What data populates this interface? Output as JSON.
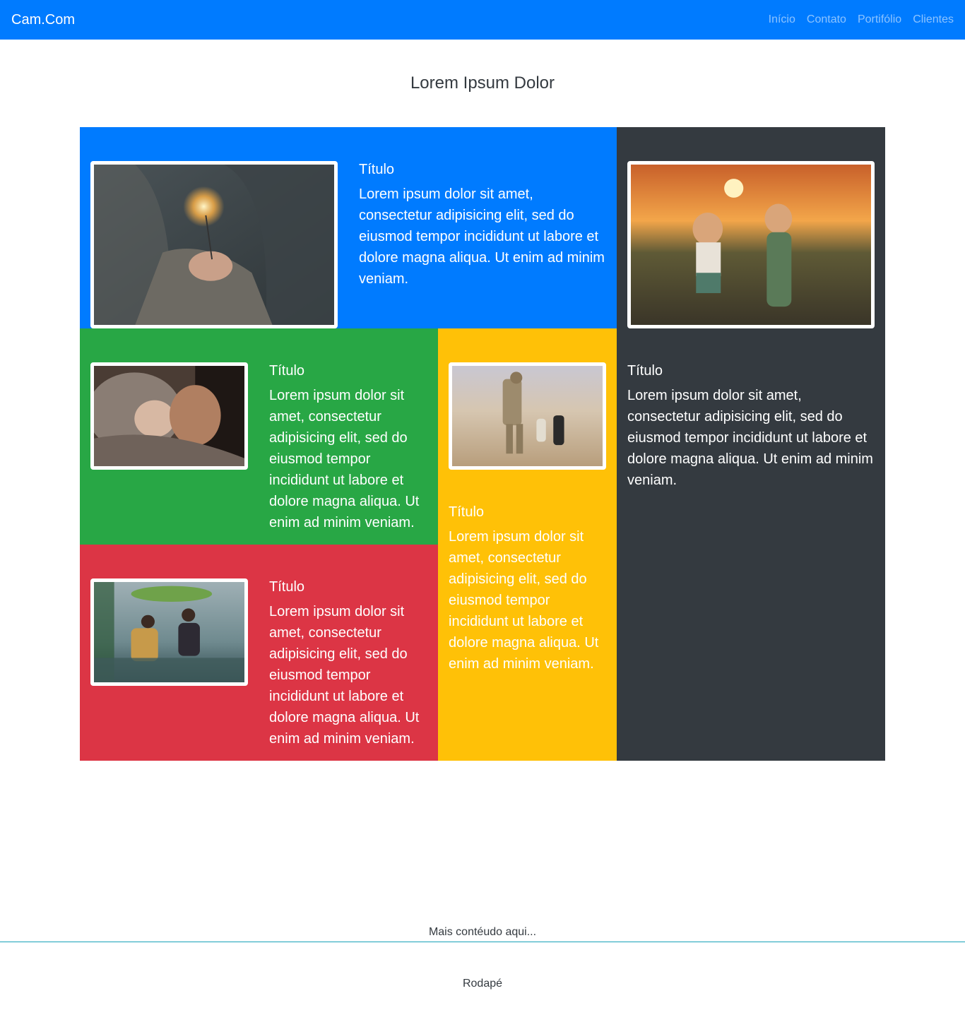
{
  "navbar": {
    "brand": "Cam.Com",
    "links": [
      "Início",
      "Contato",
      "Portifólio",
      "Clientes"
    ]
  },
  "page_title": "Lorem Ipsum Dolor",
  "cards": {
    "top_blue": {
      "title": "Título",
      "text": "Lorem ipsum dolor sit amet, consectetur adipisicing elit, sed do eiusmod tempor incididunt ut labore et dolore magna aliqua. Ut enim ad minim veniam.",
      "photo": "woman-holding-sparkler-photo"
    },
    "right_dark": {
      "title": "Título",
      "text": "Lorem ipsum dolor sit amet, consectetur adipisicing elit, sed do eiusmod tempor incididunt ut labore et dolore magna aliqua. Ut enim ad minim veniam.",
      "photo": "two-children-holding-hands-sunset-photo"
    },
    "green": {
      "title": "Título",
      "text": "Lorem ipsum dolor sit amet, consectetur adipisicing elit, sed do eiusmod tempor incididunt ut labore et dolore magna aliqua. Ut enim ad minim veniam.",
      "photo": "father-with-sleeping-baby-photo"
    },
    "yellow": {
      "title": "Título",
      "text": "Lorem ipsum dolor sit amet, consectetur adipisicing elit, sed do eiusmod tempor incididunt ut labore et dolore magna aliqua. Ut enim ad minim veniam.",
      "photo": "soldier-with-children-desert-photo"
    },
    "red": {
      "title": "Título",
      "text": "Lorem ipsum dolor sit amet, consectetur adipisicing elit, sed do eiusmod tempor incididunt ut labore et dolore magna aliqua. Ut enim ad minim veniam.",
      "photo": "children-in-rain-with-leaf-umbrella-photo"
    }
  },
  "more_content": "Mais contéudo aqui...",
  "footer": "Rodapé",
  "colors": {
    "primary": "#007bff",
    "dark": "#343a40",
    "success": "#28a745",
    "warning": "#ffc107",
    "danger": "#dc3545",
    "divider": "#17a2b8"
  }
}
